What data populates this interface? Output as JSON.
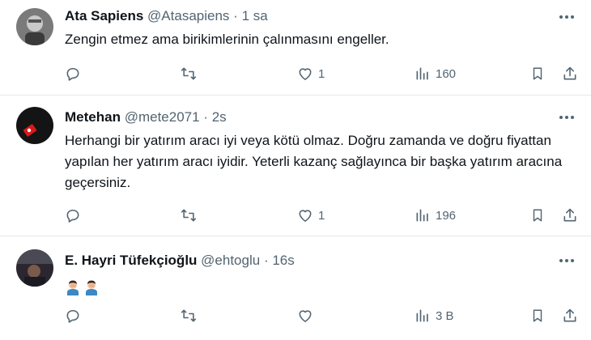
{
  "tweets": [
    {
      "name": "Ata Sapiens",
      "handle": "@Atasapiens",
      "sep": "·",
      "time": "1 sa",
      "text": "Zengin  etmez ama birikimlerinin çalınmasını engeller.",
      "replies": "",
      "retweets": "",
      "likes": "1",
      "views": "160",
      "avatar_icon": "portrait-photo"
    },
    {
      "name": "Metehan",
      "handle": "@mete2071",
      "sep": "·",
      "time": "2s",
      "text": "Herhangi bir yatırım aracı iyi veya kötü olmaz. Doğru zamanda ve doğru fiyattan yapılan her yatırım aracı iyidir. Yeterli kazanç sağlayınca bir başka yatırım aracına geçersiniz.",
      "replies": "",
      "retweets": "",
      "likes": "1",
      "views": "196",
      "avatar_icon": "turkish-flag-photo"
    },
    {
      "name": "E. Hayri Tüfekçioğlu",
      "handle": "@ehtoglu",
      "sep": "·",
      "time": "16s",
      "text": "",
      "emojis": [
        "man-facepalming-emoji",
        "man-facepalming-emoji"
      ],
      "replies": "",
      "retweets": "",
      "likes": "",
      "views": "3 B",
      "avatar_icon": "car-interior-photo"
    }
  ],
  "colors": {
    "text": "#0f1419",
    "muted": "#536471",
    "divider": "#e6e9eb"
  }
}
